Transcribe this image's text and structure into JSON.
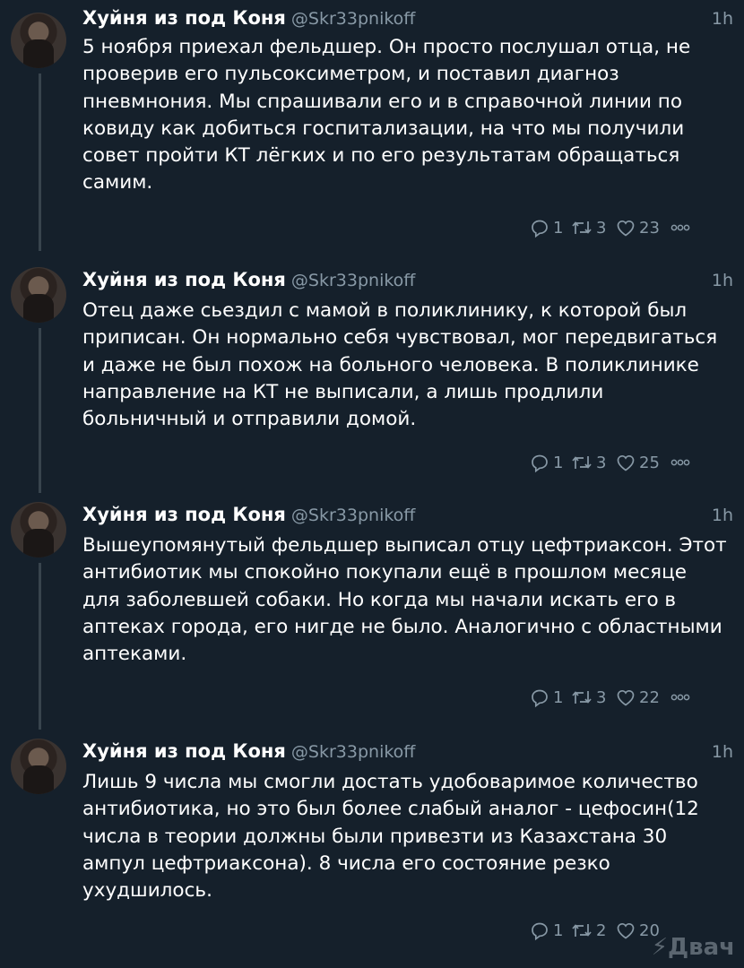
{
  "author": {
    "name": "Хуйня из под Коня",
    "handle": "@Skr33pnikoff"
  },
  "tweets": [
    {
      "time": "1h",
      "text": "5 ноября приехал фельдшер. Он просто послушал отца, не проверив его пульсоксиметром, и поставил диагноз пневмнония. Мы спрашивали его и в справочной линии по ковиду как добиться госпитализации, на что мы получили совет пройти КТ лёгких и по его результатам обращаться самим.",
      "replies": "1",
      "retweets": "3",
      "likes": "23"
    },
    {
      "time": "1h",
      "text": "Отец даже сьездил с мамой в поликлинику, к которой был приписан. Он нормально себя чувствовал, мог передвигаться и даже не был похож на больного человека. В поликлинике направление на КТ не выписали, а лишь продлили больничный и отправили домой.",
      "replies": "1",
      "retweets": "3",
      "likes": "25"
    },
    {
      "time": "1h",
      "text": "Вышеупомянутый фельдшер выписал отцу цефтриаксон. Этот антибиотик мы спокойно покупали ещё в прошлом месяце для заболевшей собаки. Но когда мы начали искать его в аптеках города, его нигде не было. Аналогично с областными аптеками.",
      "replies": "1",
      "retweets": "3",
      "likes": "22"
    },
    {
      "time": "1h",
      "text": "Лишь 9 числа мы смогли достать удобоваримое количество антибиотика, но это был более слабый аналог - цефосин(12 числа в теории должны были привезти из Казахстана 30 ампул цефтриаксона). 8 числа его состояние резко ухудшилось.",
      "replies": "1",
      "retweets": "2",
      "likes": "20"
    }
  ],
  "watermark": "Двач",
  "icons": {
    "reply": "reply-icon",
    "retweet": "retweet-icon",
    "like": "heart-icon",
    "more": "more-icon"
  }
}
